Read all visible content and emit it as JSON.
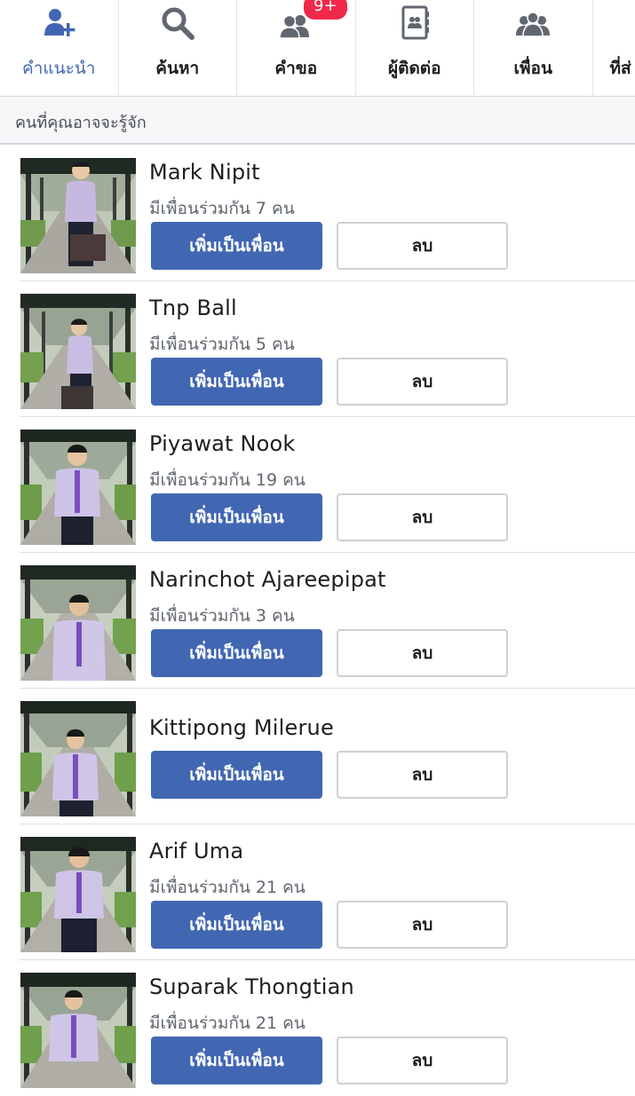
{
  "tabs": [
    {
      "id": "suggestions",
      "label": "คำแนะนำ",
      "icon": "add-friend-icon",
      "active": true,
      "badge": ""
    },
    {
      "id": "search",
      "label": "ค้นหา",
      "icon": "search-icon",
      "active": false,
      "badge": ""
    },
    {
      "id": "requests",
      "label": "คำขอ",
      "icon": "friend-requests-icon",
      "active": false,
      "badge": "9+"
    },
    {
      "id": "contacts",
      "label": "ผู้ติดต่อ",
      "icon": "contacts-book-icon",
      "active": false,
      "badge": ""
    },
    {
      "id": "friends",
      "label": "เพื่อน",
      "icon": "friends-group-icon",
      "active": false,
      "badge": ""
    },
    {
      "id": "nearby",
      "label": "ที่ส่",
      "icon": "",
      "active": false,
      "badge": ""
    }
  ],
  "section_header": "คนที่คุณอาจจะรู้จัก",
  "colors": {
    "accent": "#4267b2",
    "badge": "#f02849"
  },
  "suggestions": [
    {
      "name": "Mark Nipit",
      "mutual": "มีเพื่อนร่วมกัน 7 คน",
      "add_label": "เพิ่มเป็นเพื่อน",
      "remove_label": "ลบ"
    },
    {
      "name": "Tnp Ball",
      "mutual": "มีเพื่อนร่วมกัน 5 คน",
      "add_label": "เพิ่มเป็นเพื่อน",
      "remove_label": "ลบ"
    },
    {
      "name": "Piyawat Nook",
      "mutual": "มีเพื่อนร่วมกัน 19 คน",
      "add_label": "เพิ่มเป็นเพื่อน",
      "remove_label": "ลบ"
    },
    {
      "name": "Narinchot Ajareepipat",
      "mutual": "มีเพื่อนร่วมกัน 3 คน",
      "add_label": "เพิ่มเป็นเพื่อน",
      "remove_label": "ลบ"
    },
    {
      "name": "Kittipong Milerue",
      "mutual": "",
      "add_label": "เพิ่มเป็นเพื่อน",
      "remove_label": "ลบ"
    },
    {
      "name": "Arif Uma",
      "mutual": "มีเพื่อนร่วมกัน 21 คน",
      "add_label": "เพิ่มเป็นเพื่อน",
      "remove_label": "ลบ"
    },
    {
      "name": "Suparak Thongtian",
      "mutual": "มีเพื่อนร่วมกัน 21 คน",
      "add_label": "เพิ่มเป็นเพื่อน",
      "remove_label": "ลบ"
    }
  ]
}
